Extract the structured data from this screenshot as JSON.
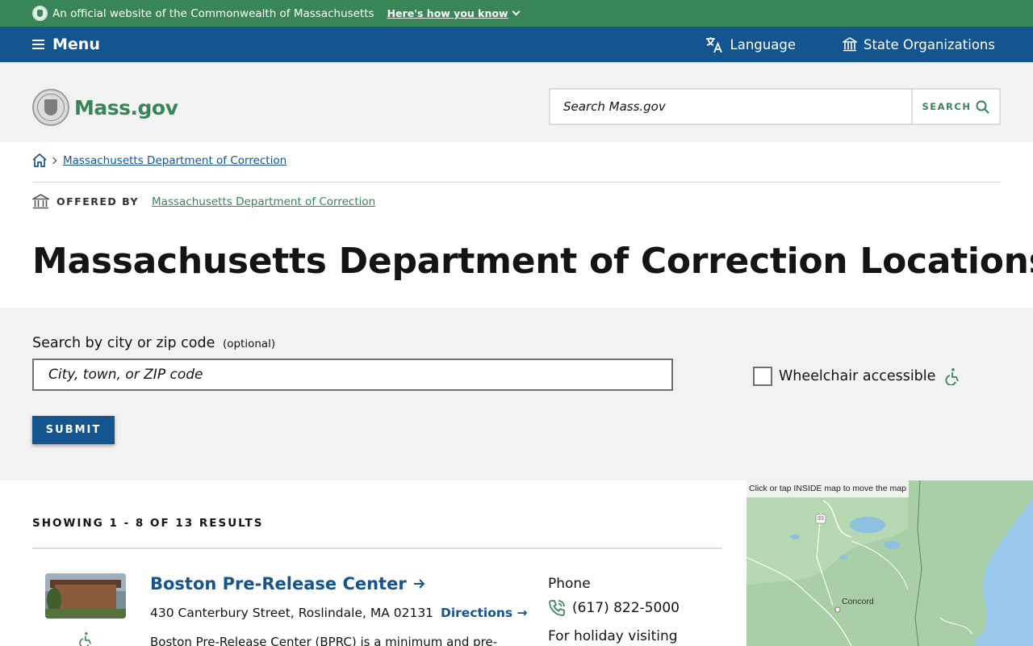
{
  "banner": {
    "text": "An official website of the Commonwealth of Massachusetts",
    "link": "Here's how you know"
  },
  "utility_nav": {
    "menu": "Menu",
    "language": "Language",
    "state_orgs": "State Organizations"
  },
  "header": {
    "logo_text": "Mass.gov",
    "search_placeholder": "Search Mass.gov",
    "search_button": "SEARCH"
  },
  "breadcrumb": {
    "items": [
      "Massachusetts Department of Correction"
    ]
  },
  "offered_by": {
    "label": "OFFERED BY",
    "org": "Massachusetts Department of Correction"
  },
  "page_title": "Massachusetts Department of Correction Locations",
  "filters": {
    "label": "Search by city or zip code",
    "optional": "(optional)",
    "input_placeholder": "City, town, or ZIP code",
    "wheelchair_label": "Wheelchair accessible",
    "wheelchair_checked": false,
    "submit": "SUBMIT"
  },
  "results": {
    "showing": "SHOWING 1 - 8 OF 13 RESULTS",
    "items": [
      {
        "title": "Boston Pre-Release Center",
        "address": "430 Canterbury Street, Roslindale, MA 02131",
        "directions": "Directions",
        "description": "Boston Pre-Release Center (BPRC) is a minimum and pre-",
        "phone_label": "Phone",
        "phone": "(617) 822-5000",
        "extra_label": "For holiday visiting"
      }
    ]
  },
  "map": {
    "note": "Click or tap INSIDE map to move the map",
    "labels": [
      "Concord",
      "93"
    ]
  },
  "colors": {
    "green": "#388557",
    "blue": "#14558f",
    "light_gray": "#f2f2f2"
  }
}
